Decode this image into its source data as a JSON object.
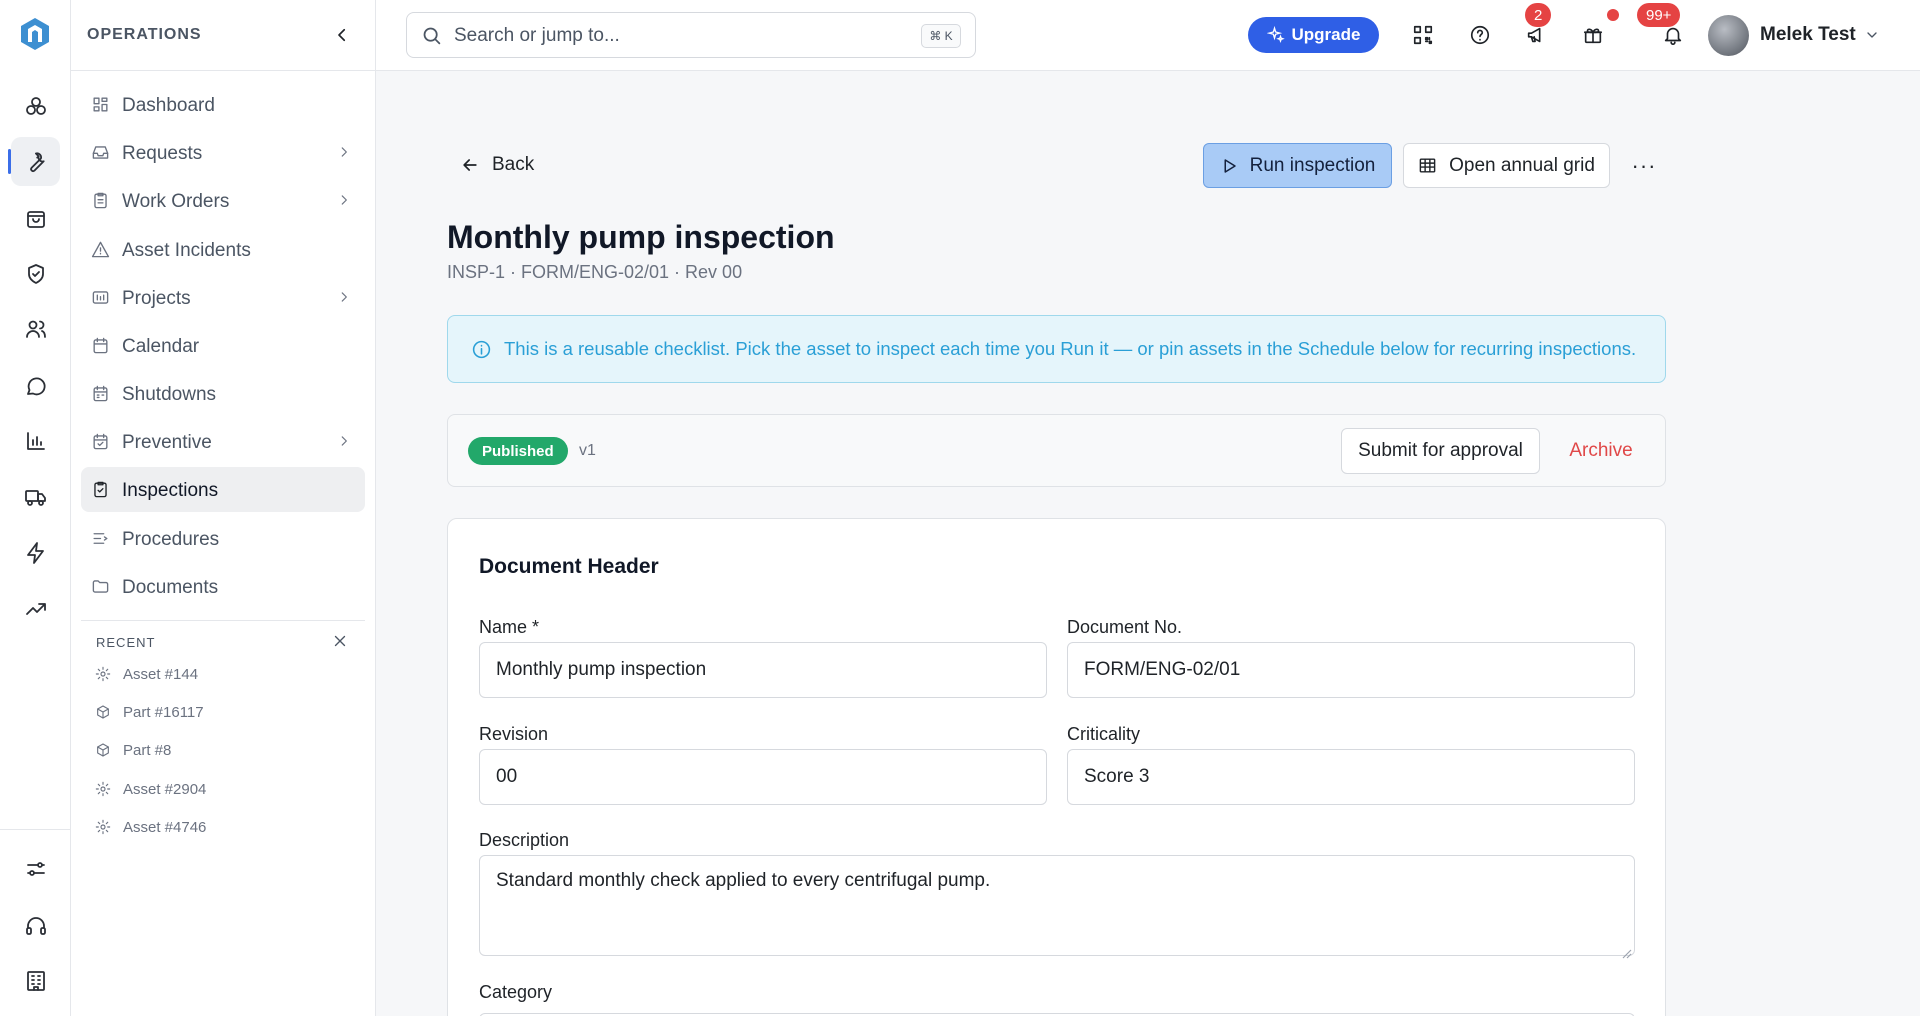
{
  "sidebar": {
    "section_title": "OPERATIONS",
    "items": [
      {
        "label": "Dashboard"
      },
      {
        "label": "Requests"
      },
      {
        "label": "Work Orders"
      },
      {
        "label": "Asset Incidents"
      },
      {
        "label": "Projects"
      },
      {
        "label": "Calendar"
      },
      {
        "label": "Shutdowns"
      },
      {
        "label": "Preventive"
      },
      {
        "label": "Inspections",
        "active": true
      },
      {
        "label": "Procedures"
      },
      {
        "label": "Documents"
      }
    ],
    "recent_title": "RECENT",
    "recent": [
      {
        "label": "Asset #144",
        "icon": "gear-icon"
      },
      {
        "label": "Part #16117",
        "icon": "box-icon"
      },
      {
        "label": "Part #8",
        "icon": "box-icon"
      },
      {
        "label": "Asset #2904",
        "icon": "gear-icon"
      },
      {
        "label": "Asset #4746",
        "icon": "gear-icon"
      }
    ]
  },
  "topbar": {
    "search_placeholder": "Search or jump to...",
    "search_shortcut": "⌘ K",
    "upgrade_label": "Upgrade",
    "announcements_badge": "2",
    "notifications_badge": "99+",
    "user_name": "Melek Test"
  },
  "page": {
    "back_label": "Back",
    "run_label": "Run inspection",
    "grid_label": "Open annual grid",
    "more_label": "···",
    "title": "Monthly pump inspection",
    "subtitle": "INSP-1 · FORM/ENG-02/01 · Rev 00",
    "info_text": "This is a reusable checklist. Pick the asset to inspect each time you Run it — or pin assets in the Schedule below for recurring inspections.",
    "status": "Published",
    "version": "v1",
    "submit_label": "Submit for approval",
    "archive_label": "Archive"
  },
  "form": {
    "section_title": "Document Header",
    "name_label": "Name *",
    "name_value": "Monthly pump inspection",
    "docno_label": "Document No.",
    "docno_value": "FORM/ENG-02/01",
    "revision_label": "Revision",
    "revision_value": "00",
    "criticality_label": "Criticality",
    "criticality_value": "Score 3",
    "description_label": "Description",
    "description_value": "Standard monthly check applied to every centrifugal pump.",
    "category_label": "Category"
  },
  "colors": {
    "accent": "#2f5fe6",
    "published": "#22a86a",
    "danger": "#e04848",
    "info": "#2a9fd6"
  }
}
